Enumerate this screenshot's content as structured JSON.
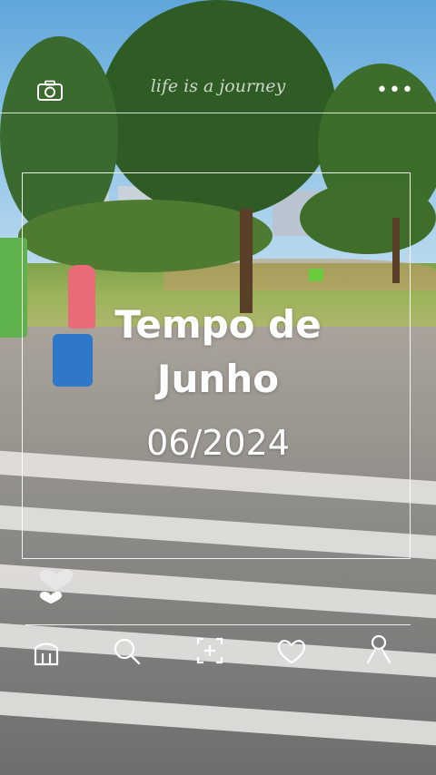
{
  "overlay": {
    "script_text": "life is a journey",
    "title_line1": "Tempo de",
    "title_line2": "Junho",
    "date": "06/2024"
  },
  "icons": {
    "top_left": "camera-icon",
    "top_right": "more-icon",
    "likes": "heart-icon",
    "nav": [
      "home-icon",
      "search-icon",
      "add-photo-icon",
      "heart-outline-icon",
      "profile-icon"
    ]
  },
  "colors": {
    "overlay": "#ffffff",
    "sky": "#8ec3e8",
    "grass": "#9bb45a",
    "road": "#8f8d89"
  }
}
